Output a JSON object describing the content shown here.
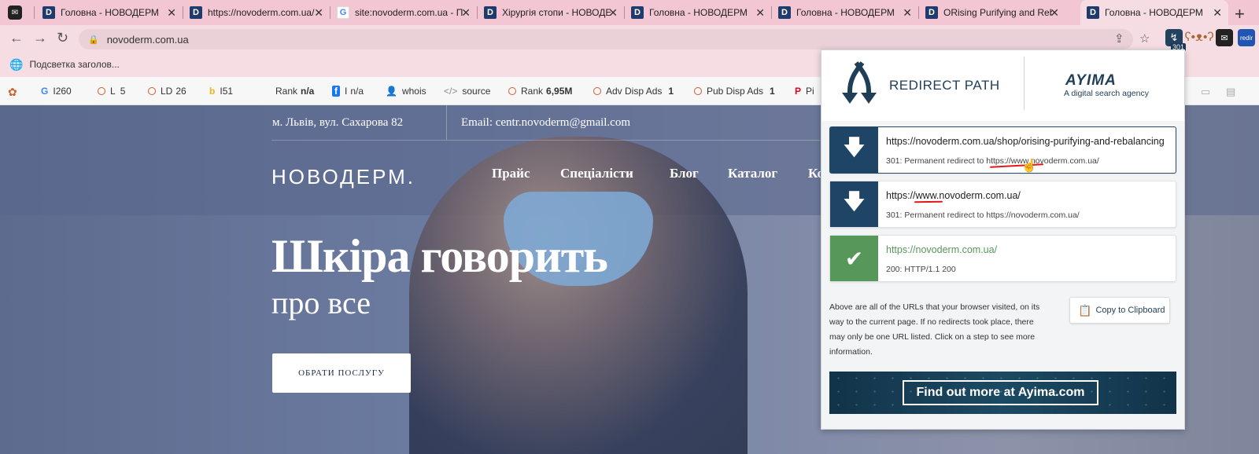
{
  "browser": {
    "tabs": [
      {
        "title": "Головна - НОВОДЕРМ",
        "icon": "novoderm-favicon"
      },
      {
        "title": "https://novoderm.com.ua/",
        "icon": "novoderm-favicon"
      },
      {
        "title": "site:novoderm.com.ua - П",
        "icon": "google-favicon"
      },
      {
        "title": "Хірургія стопи - НОВОДЕ",
        "icon": "novoderm-favicon"
      },
      {
        "title": "Головна - НОВОДЕРМ",
        "icon": "novoderm-favicon"
      },
      {
        "title": "Головна - НОВОДЕРМ",
        "icon": "novoderm-favicon"
      },
      {
        "title": "ORising Purifying and Reb",
        "icon": "novoderm-favicon"
      },
      {
        "title": "Головна - НОВОДЕРМ",
        "icon": "novoderm-favicon",
        "active": true
      }
    ],
    "address": "novoderm.com.ua",
    "extension_badge": "301",
    "extension_redir_label": "redir",
    "bookmark": "Подсветка заголов..."
  },
  "seo_toolbar": {
    "items": [
      {
        "label": "I",
        "value": "260"
      },
      {
        "label": "L",
        "value": "5"
      },
      {
        "label": "LD",
        "value": "26"
      },
      {
        "label": "I",
        "value": "51"
      },
      {
        "label": "Rank",
        "value": "n/a"
      },
      {
        "label": "I",
        "value": "n/a"
      },
      {
        "label": "whois",
        "value": ""
      },
      {
        "label": "source",
        "value": ""
      },
      {
        "label": "Rank",
        "value": "6,95M"
      },
      {
        "label": "Adv Disp Ads",
        "value": "1"
      },
      {
        "label": "Pub Disp Ads",
        "value": "1"
      },
      {
        "label": "Pi",
        "value": ""
      }
    ]
  },
  "website": {
    "address": "м. Львів, вул. Сахарова 82",
    "email": "Email: centr.novoderm@gmail.com",
    "logo": "НОВОДЕРМ.",
    "nav": [
      "Прайс",
      "Спеціалісти",
      "Блог",
      "Каталог",
      "Ко"
    ],
    "hero_title": "Шкіра говорить",
    "hero_subtitle": "про все",
    "cta": "ОБРАТИ ПОСЛУГУ"
  },
  "redirect_path": {
    "title": "REDIRECT PATH",
    "partner_logo": "AYIMA",
    "partner_tagline": "A digital search agency",
    "hops": [
      {
        "url": "https://novoderm.com.ua/shop/orising-purifying-and-rebalancing",
        "status": "301: Permanent redirect to https://www.novoderm.com.ua/",
        "kind": "redirect"
      },
      {
        "url": "https://www.novoderm.com.ua/",
        "status": "301: Permanent redirect to https://novoderm.com.ua/",
        "kind": "redirect"
      },
      {
        "url": "https://novoderm.com.ua/",
        "status": "200: HTTP/1.1 200",
        "kind": "ok"
      }
    ],
    "info": "Above are all of the URLs that your browser visited, on its way to the current page. If no redirects took place, there may only be one URL listed. Click on a step to see more information.",
    "copy_label": "Copy to Clipboard",
    "banner": "Find out more at Ayima.com",
    "colors": {
      "redirect": "#1e4466",
      "ok": "#57985a",
      "annotation": "#e01818"
    }
  }
}
